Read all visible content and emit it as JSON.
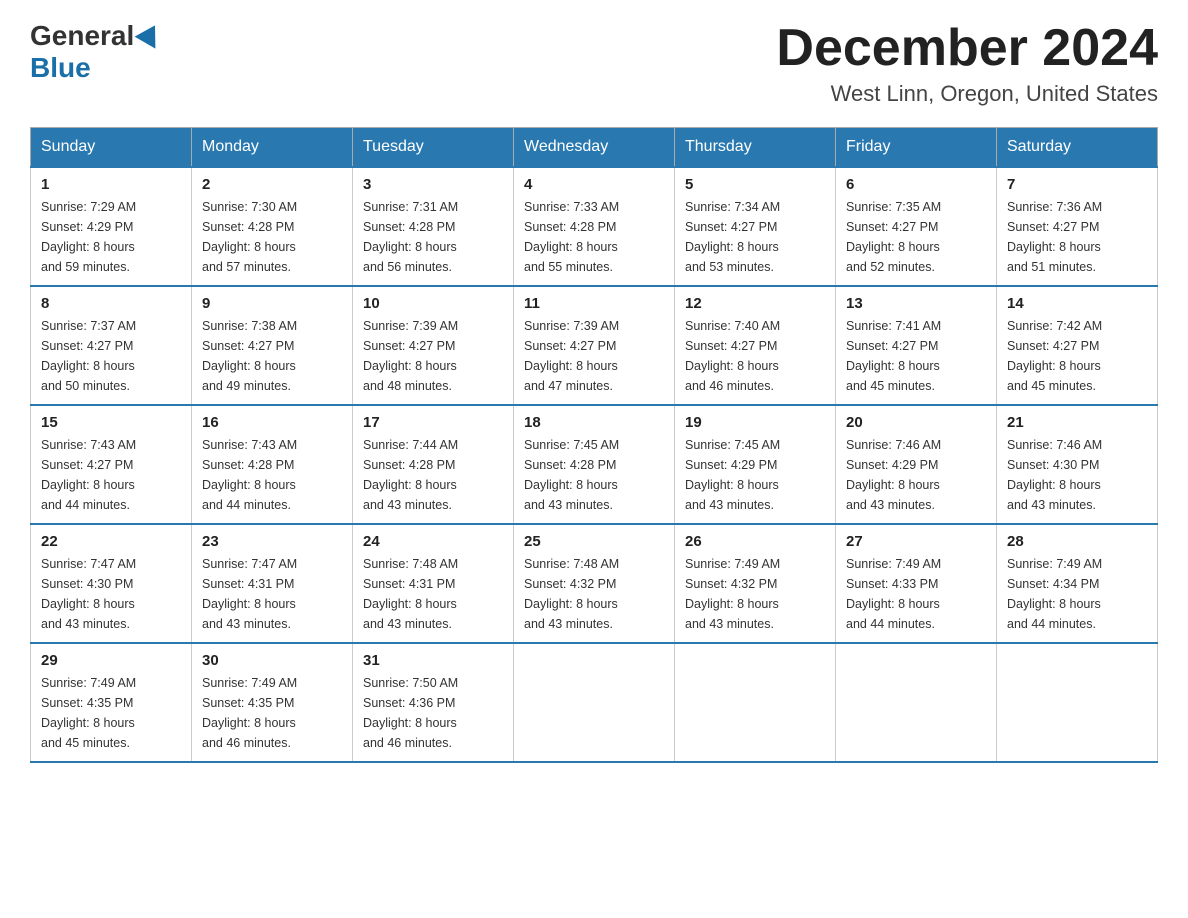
{
  "header": {
    "logo_general": "General",
    "logo_blue": "Blue",
    "month_title": "December 2024",
    "location": "West Linn, Oregon, United States"
  },
  "days_of_week": [
    "Sunday",
    "Monday",
    "Tuesday",
    "Wednesday",
    "Thursday",
    "Friday",
    "Saturday"
  ],
  "weeks": [
    [
      {
        "day": "1",
        "sunrise": "7:29 AM",
        "sunset": "4:29 PM",
        "daylight_h": "8",
        "daylight_m": "59"
      },
      {
        "day": "2",
        "sunrise": "7:30 AM",
        "sunset": "4:28 PM",
        "daylight_h": "8",
        "daylight_m": "57"
      },
      {
        "day": "3",
        "sunrise": "7:31 AM",
        "sunset": "4:28 PM",
        "daylight_h": "8",
        "daylight_m": "56"
      },
      {
        "day": "4",
        "sunrise": "7:33 AM",
        "sunset": "4:28 PM",
        "daylight_h": "8",
        "daylight_m": "55"
      },
      {
        "day": "5",
        "sunrise": "7:34 AM",
        "sunset": "4:27 PM",
        "daylight_h": "8",
        "daylight_m": "53"
      },
      {
        "day": "6",
        "sunrise": "7:35 AM",
        "sunset": "4:27 PM",
        "daylight_h": "8",
        "daylight_m": "52"
      },
      {
        "day": "7",
        "sunrise": "7:36 AM",
        "sunset": "4:27 PM",
        "daylight_h": "8",
        "daylight_m": "51"
      }
    ],
    [
      {
        "day": "8",
        "sunrise": "7:37 AM",
        "sunset": "4:27 PM",
        "daylight_h": "8",
        "daylight_m": "50"
      },
      {
        "day": "9",
        "sunrise": "7:38 AM",
        "sunset": "4:27 PM",
        "daylight_h": "8",
        "daylight_m": "49"
      },
      {
        "day": "10",
        "sunrise": "7:39 AM",
        "sunset": "4:27 PM",
        "daylight_h": "8",
        "daylight_m": "48"
      },
      {
        "day": "11",
        "sunrise": "7:39 AM",
        "sunset": "4:27 PM",
        "daylight_h": "8",
        "daylight_m": "47"
      },
      {
        "day": "12",
        "sunrise": "7:40 AM",
        "sunset": "4:27 PM",
        "daylight_h": "8",
        "daylight_m": "46"
      },
      {
        "day": "13",
        "sunrise": "7:41 AM",
        "sunset": "4:27 PM",
        "daylight_h": "8",
        "daylight_m": "45"
      },
      {
        "day": "14",
        "sunrise": "7:42 AM",
        "sunset": "4:27 PM",
        "daylight_h": "8",
        "daylight_m": "45"
      }
    ],
    [
      {
        "day": "15",
        "sunrise": "7:43 AM",
        "sunset": "4:27 PM",
        "daylight_h": "8",
        "daylight_m": "44"
      },
      {
        "day": "16",
        "sunrise": "7:43 AM",
        "sunset": "4:28 PM",
        "daylight_h": "8",
        "daylight_m": "44"
      },
      {
        "day": "17",
        "sunrise": "7:44 AM",
        "sunset": "4:28 PM",
        "daylight_h": "8",
        "daylight_m": "43"
      },
      {
        "day": "18",
        "sunrise": "7:45 AM",
        "sunset": "4:28 PM",
        "daylight_h": "8",
        "daylight_m": "43"
      },
      {
        "day": "19",
        "sunrise": "7:45 AM",
        "sunset": "4:29 PM",
        "daylight_h": "8",
        "daylight_m": "43"
      },
      {
        "day": "20",
        "sunrise": "7:46 AM",
        "sunset": "4:29 PM",
        "daylight_h": "8",
        "daylight_m": "43"
      },
      {
        "day": "21",
        "sunrise": "7:46 AM",
        "sunset": "4:30 PM",
        "daylight_h": "8",
        "daylight_m": "43"
      }
    ],
    [
      {
        "day": "22",
        "sunrise": "7:47 AM",
        "sunset": "4:30 PM",
        "daylight_h": "8",
        "daylight_m": "43"
      },
      {
        "day": "23",
        "sunrise": "7:47 AM",
        "sunset": "4:31 PM",
        "daylight_h": "8",
        "daylight_m": "43"
      },
      {
        "day": "24",
        "sunrise": "7:48 AM",
        "sunset": "4:31 PM",
        "daylight_h": "8",
        "daylight_m": "43"
      },
      {
        "day": "25",
        "sunrise": "7:48 AM",
        "sunset": "4:32 PM",
        "daylight_h": "8",
        "daylight_m": "43"
      },
      {
        "day": "26",
        "sunrise": "7:49 AM",
        "sunset": "4:32 PM",
        "daylight_h": "8",
        "daylight_m": "43"
      },
      {
        "day": "27",
        "sunrise": "7:49 AM",
        "sunset": "4:33 PM",
        "daylight_h": "8",
        "daylight_m": "44"
      },
      {
        "day": "28",
        "sunrise": "7:49 AM",
        "sunset": "4:34 PM",
        "daylight_h": "8",
        "daylight_m": "44"
      }
    ],
    [
      {
        "day": "29",
        "sunrise": "7:49 AM",
        "sunset": "4:35 PM",
        "daylight_h": "8",
        "daylight_m": "45"
      },
      {
        "day": "30",
        "sunrise": "7:49 AM",
        "sunset": "4:35 PM",
        "daylight_h": "8",
        "daylight_m": "46"
      },
      {
        "day": "31",
        "sunrise": "7:50 AM",
        "sunset": "4:36 PM",
        "daylight_h": "8",
        "daylight_m": "46"
      },
      null,
      null,
      null,
      null
    ]
  ]
}
